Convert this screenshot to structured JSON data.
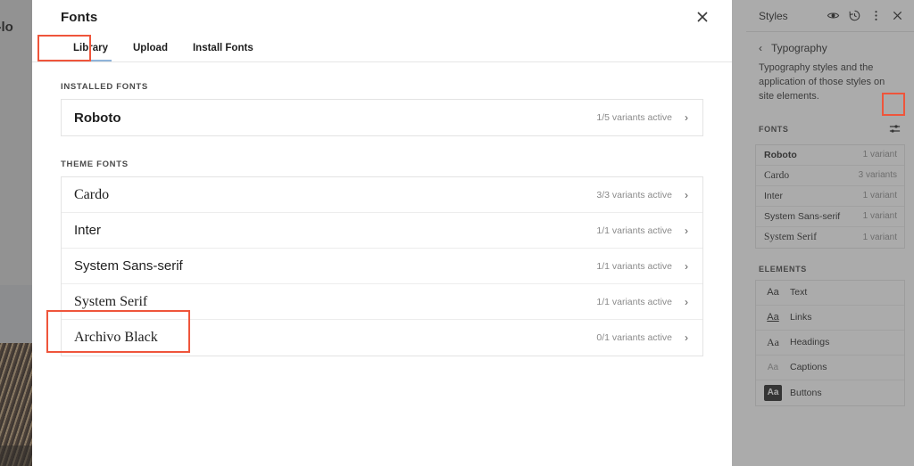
{
  "background_site": {
    "heading_fragment": "ent-lo"
  },
  "modal": {
    "title": "Fonts",
    "close_icon": "close-icon",
    "tabs": [
      {
        "label": "Library",
        "active": true
      },
      {
        "label": "Upload",
        "active": false
      },
      {
        "label": "Install Fonts",
        "active": false
      }
    ],
    "sections": [
      {
        "label": "Installed Fonts",
        "fonts": [
          {
            "name": "Roboto",
            "variants": "1/5 variants active",
            "style": "installed"
          }
        ]
      },
      {
        "label": "Theme Fonts",
        "fonts": [
          {
            "name": "Cardo",
            "variants": "3/3 variants active",
            "style": "serif"
          },
          {
            "name": "Inter",
            "variants": "1/1 variants active",
            "style": "sans"
          },
          {
            "name": "System Sans-serif",
            "variants": "1/1 variants active",
            "style": "sans"
          },
          {
            "name": "System Serif",
            "variants": "1/1 variants active",
            "style": "serif"
          },
          {
            "name": "Archivo Black",
            "variants": "0/1 variants active",
            "style": "serif"
          }
        ]
      }
    ],
    "chevron": "›"
  },
  "sidebar": {
    "title": "Styles",
    "header_icons": [
      "eye-icon",
      "revisions-icon",
      "more-options-icon",
      "close-icon"
    ],
    "back_chevron": "‹",
    "nav_title": "Typography",
    "description": "Typography styles and the application of those styles on site elements.",
    "fonts_section": {
      "label": "Fonts",
      "filter_icon": "sliders-filter-icon",
      "items": [
        {
          "name": "Roboto",
          "variants": "1 variant",
          "style": "bold"
        },
        {
          "name": "Cardo",
          "variants": "3 variants",
          "style": "serif"
        },
        {
          "name": "Inter",
          "variants": "1 variant",
          "style": "sans"
        },
        {
          "name": "System Sans-serif",
          "variants": "1 variant",
          "style": "sans"
        },
        {
          "name": "System Serif",
          "variants": "1 variant",
          "style": "serif"
        }
      ]
    },
    "elements_section": {
      "label": "Elements",
      "items": [
        {
          "label": "Text",
          "chip": "Aa",
          "chip_style": "text"
        },
        {
          "label": "Links",
          "chip": "Aa",
          "chip_style": "links"
        },
        {
          "label": "Headings",
          "chip": "Aa",
          "chip_style": "headings"
        },
        {
          "label": "Captions",
          "chip": "Aa",
          "chip_style": "captions"
        },
        {
          "label": "Buttons",
          "chip": "Aa",
          "chip_style": "buttons"
        }
      ]
    }
  },
  "annotations": {
    "accent_color": "#ef553b",
    "highlighted": [
      "Library tab",
      "Archivo Black row",
      "Fonts filter button"
    ]
  }
}
